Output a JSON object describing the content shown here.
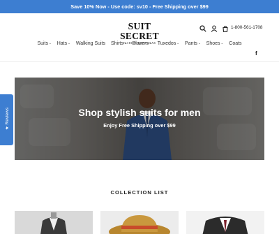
{
  "announcement": "Save 10% Now - Use code: sv10 - Free Shipping over $99",
  "logo": {
    "name": "SUIT SECRET",
    "tagline": "FASHION MENSWEAR"
  },
  "header": {
    "phone": "1-800-561-1708",
    "icons": [
      "search-icon",
      "account-icon",
      "cart-icon"
    ]
  },
  "nav": [
    {
      "label": "Suits",
      "dropdown": true
    },
    {
      "label": "Hats",
      "dropdown": true
    },
    {
      "label": "Walking Suits",
      "dropdown": false
    },
    {
      "label": "Shirts",
      "dropdown": true
    },
    {
      "label": "Blazers",
      "dropdown": true
    },
    {
      "label": "Tuxedos",
      "dropdown": true
    },
    {
      "label": "Pants",
      "dropdown": true
    },
    {
      "label": "Shoes",
      "dropdown": true
    },
    {
      "label": "Coats",
      "dropdown": false
    }
  ],
  "social": {
    "facebook": "f"
  },
  "hero": {
    "title": "Shop stylish suits for men",
    "subtitle": "Enjoy Free Shipping over $99"
  },
  "reviews_tab": {
    "label": "★ Reviews"
  },
  "collection": {
    "heading": "COLLECTION LIST",
    "cards": [
      {
        "icon": "suit-mannequin-image"
      },
      {
        "icon": "hat-image"
      },
      {
        "icon": "suit-jacket-image"
      }
    ]
  },
  "colors": {
    "accent": "#3d7ed1"
  }
}
